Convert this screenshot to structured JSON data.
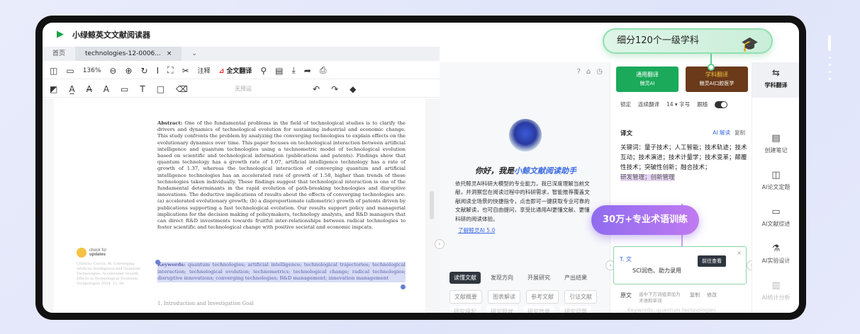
{
  "app": {
    "title": "小绿鲸英文文献阅读器"
  },
  "tabs": [
    {
      "label": "首页"
    },
    {
      "label": "technologies-12-0006..."
    }
  ],
  "toolbar": {
    "zoom": "136%",
    "annotate": "注释",
    "full_translate": "全文翻译",
    "preset": "无预设",
    "icons": [
      "panel-icon",
      "pages-icon",
      "zoom-out-icon",
      "zoom-in-icon",
      "rotate-icon",
      "cursor-icon",
      "fullscreen-icon",
      "cut-icon",
      "search-icon",
      "comment-icon",
      "download-icon",
      "share-icon",
      "print-icon",
      "underline-icon",
      "strikethrough-icon",
      "squiggly-icon",
      "note-icon",
      "text-icon",
      "rectangle-icon",
      "eraser-icon",
      "undo-icon",
      "redo-icon",
      "clear-icon"
    ]
  },
  "document": {
    "abstract_label": "Abstract:",
    "abstract_text": "One of the fundamental problems in the field of technological studies is to clarify the drivers and dynamics of technological evolution for sustaining industrial and economic change. This study confronts the problem by analyzing the converging technologies to explain effects on the evolutionary dynamics over time. This paper focuses on technological interaction between artificial intelligence and quantum technologies using a technometric model of technological evolution based on scientific and technological information (publications and patents). Findings show that quantum technology has a growth rate of 1.07, artificial intelligence technology has a rate of growth of 1.37, whereas the technological interaction of converging quantum and artificial intelligence technologies has an accelerated rate of growth of 1.58, higher than trends of these technologies taken individually. These findings suggest that technological interaction is one of the fundamental determinants in the rapid evolution of path-breaking technologies and disruptive innovations. The deductive implications of results about the effects of converging technologies are: (a) accelerated evolutionary growth; (b) a disproportionate (allometric) growth of patents driven by publications supporting a fast technological evolution. Our results support policy and managerial implications for the decision making of policymakers, technology analysts, and R&D managers that can direct R&D investments towards fruitful inter-relationships between radical technologies to foster scientific and technological change with positive societal and economic impcats.",
    "keywords_label": "Keywords:",
    "keywords_text": "quantum technologies; artificial intelligence; technological trajectories; technological interaction; technological evolution; technometrics; technological change; radical technologies; disruptive innovations; converging technologies; R&D management; innovation management",
    "section": "1. Introduction and Investigation Goal",
    "check_updates": [
      "check for",
      "updates"
    ],
    "citation": "Citation: Coccia, M. Converging Artificial Intelligence and Quantum Technologies: Accelerated Growth Effects in Technological Evolution. Technologies 2024, 12, 66."
  },
  "assistant": {
    "greeting_prefix": "你好，我是",
    "greeting_name": "小鲸文献阅读助手",
    "intro": "依托鲸灵AI科研大模型的专业能力，我已深度理解当前文献，并洞察您在阅读过程中的科研需求，智能推荐覆盖文献阅读全场景的快捷指令，点击即可一键获取专业可靠的文献解读，也可自由提问，享受比通用AI更懂文献、更懂科研的阅读体验。",
    "learn_more": "了解鲸灵AI 5.0",
    "chips_row1": [
      "读懂文献",
      "发现方向",
      "开展研究",
      "产出结果"
    ],
    "chips_row2": [
      "文献概要",
      "图表解读",
      "参考文献",
      "引证文献"
    ],
    "chips_row3": [
      "研究缘起",
      "研究现状",
      "研究背景",
      "研究问题"
    ]
  },
  "translate": {
    "general_label": "通用翻译",
    "general_sub": "鲸灵AI",
    "subject_label": "学科翻译",
    "subject_sub": "鲸灵AI口腔医学",
    "opt_lock": "锁定",
    "opt_continuous": "连续翻译",
    "opt_fontsize": "14 ▾ 字号",
    "opt_follow": "跟随",
    "heading": "译文",
    "ai_read": "AI 解读",
    "copy": "复制",
    "text": "关键词：量子技术；人工智能；技术轨迹；技术互动；技术演进；技术计量学；技术变革；颠覆性技术；突破性创新；融合技术；",
    "highlight": "研发管理；创新管理",
    "popup_title": "T. 文",
    "popup_desc": "SCI润色、助力录用",
    "popup_go": "前往查看",
    "orig_label": "原文",
    "orig_hint": "选中下方词组添加为术语和单词",
    "orig_copy": "复制",
    "orig_edit": "修改",
    "orig_fade": "Keywords: quantum technologies"
  },
  "side": {
    "items": [
      {
        "label": "学科翻译",
        "icon": "translate-icon"
      },
      {
        "label": "创建笔记",
        "icon": "note-icon"
      },
      {
        "label": "AI论文定题",
        "icon": "topic-icon"
      },
      {
        "label": "AI文献综述",
        "icon": "review-icon"
      },
      {
        "label": "AI实验设计",
        "icon": "flask-icon"
      },
      {
        "label": "AI统计分析",
        "icon": "stats-icon"
      }
    ]
  },
  "callouts": {
    "subjects": "细分120个一级学科",
    "terms": "30万+专业术语训练"
  }
}
